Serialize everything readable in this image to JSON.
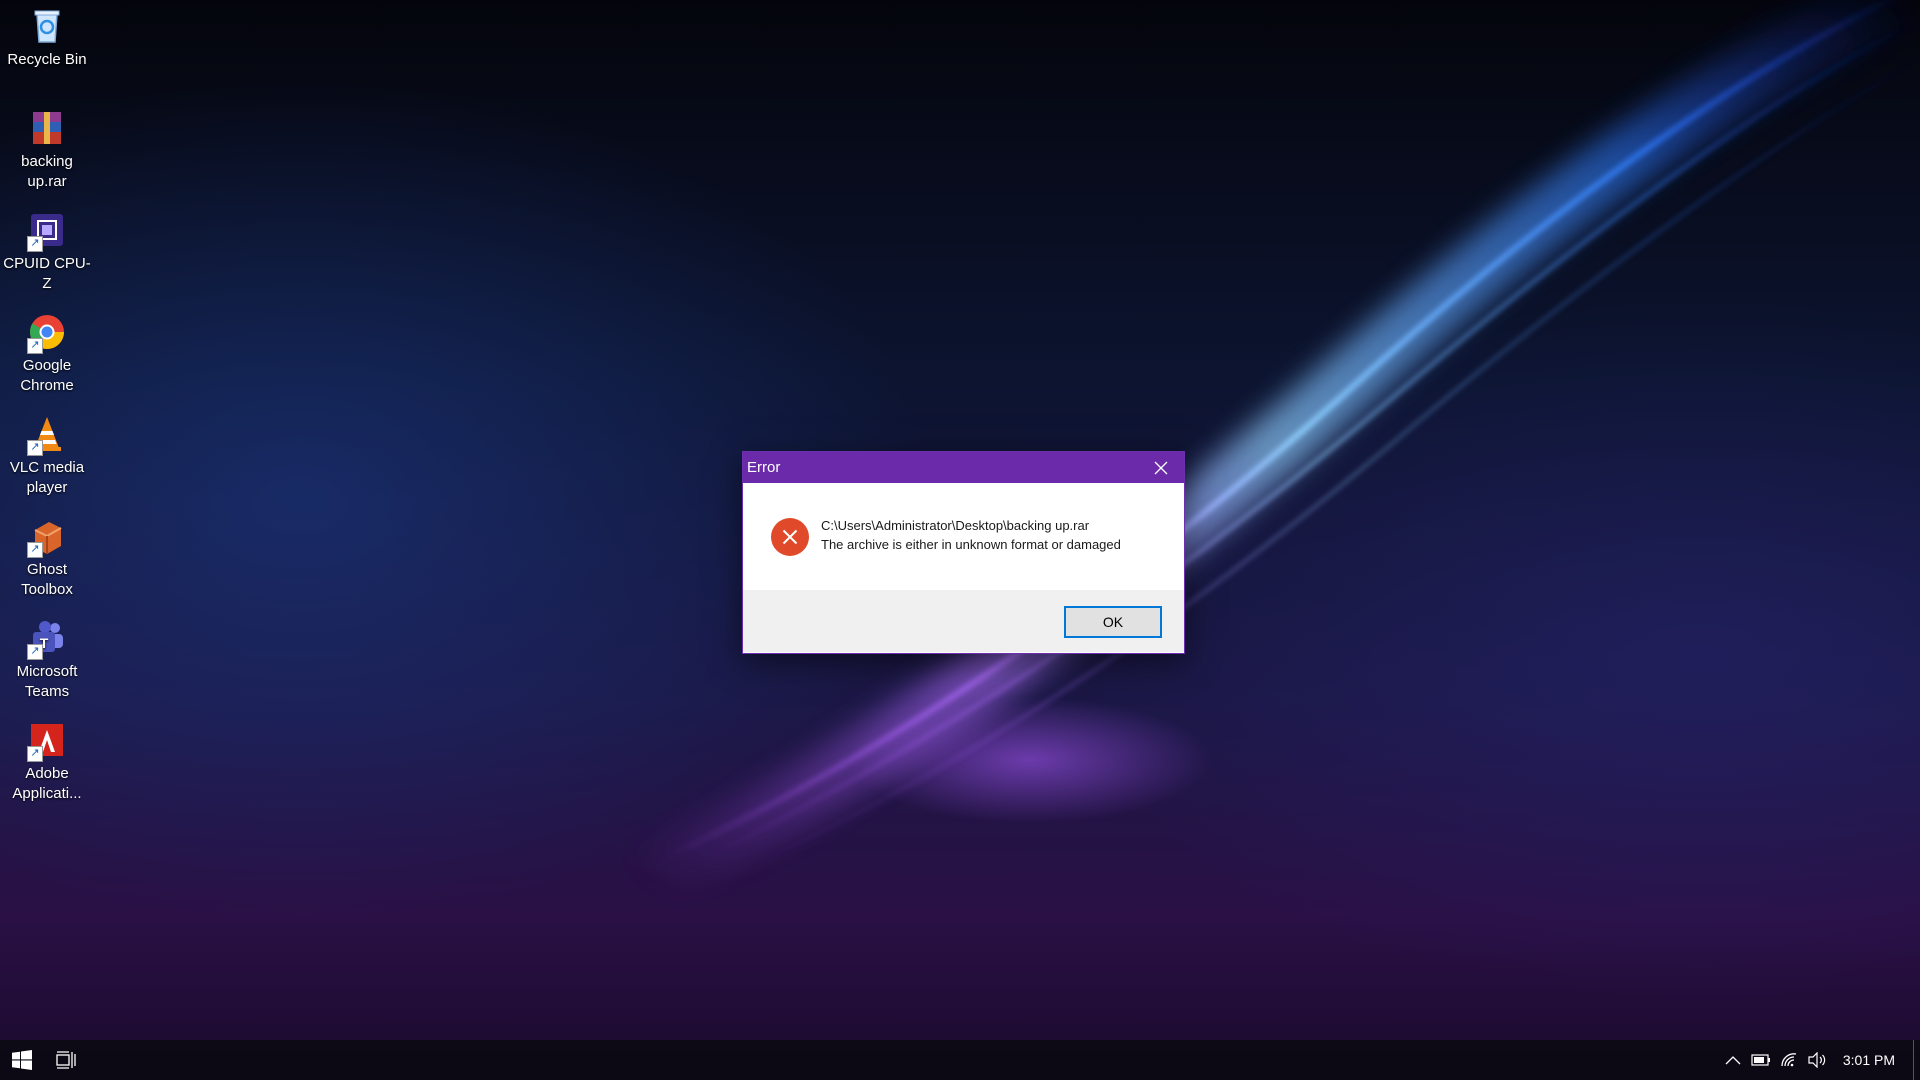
{
  "desktop": {
    "icons": [
      {
        "label": "Recycle Bin",
        "icon": "recycle-bin-icon"
      },
      {
        "label": "backing up.rar",
        "icon": "winrar-archive-icon"
      },
      {
        "label": "CPUID CPU-Z",
        "icon": "cpuz-icon"
      },
      {
        "label": "Google Chrome",
        "icon": "chrome-icon"
      },
      {
        "label": "VLC media player",
        "icon": "vlc-icon"
      },
      {
        "label": "Ghost Toolbox",
        "icon": "ghost-toolbox-icon"
      },
      {
        "label": "Microsoft Teams",
        "icon": "teams-icon"
      },
      {
        "label": "Adobe Applicati...",
        "icon": "adobe-icon"
      }
    ]
  },
  "dialog": {
    "title": "Error",
    "message_path": "C:\\Users\\Administrator\\Desktop\\backing up.rar",
    "message_text": "The archive is either in unknown format or damaged",
    "ok_label": "OK",
    "icon": "error-icon",
    "title_color": "#6a2aa9"
  },
  "taskbar": {
    "clock": "3:01 PM",
    "tray_icons": [
      "chevron-up-icon",
      "battery-icon",
      "wifi-icon",
      "volume-icon"
    ]
  }
}
